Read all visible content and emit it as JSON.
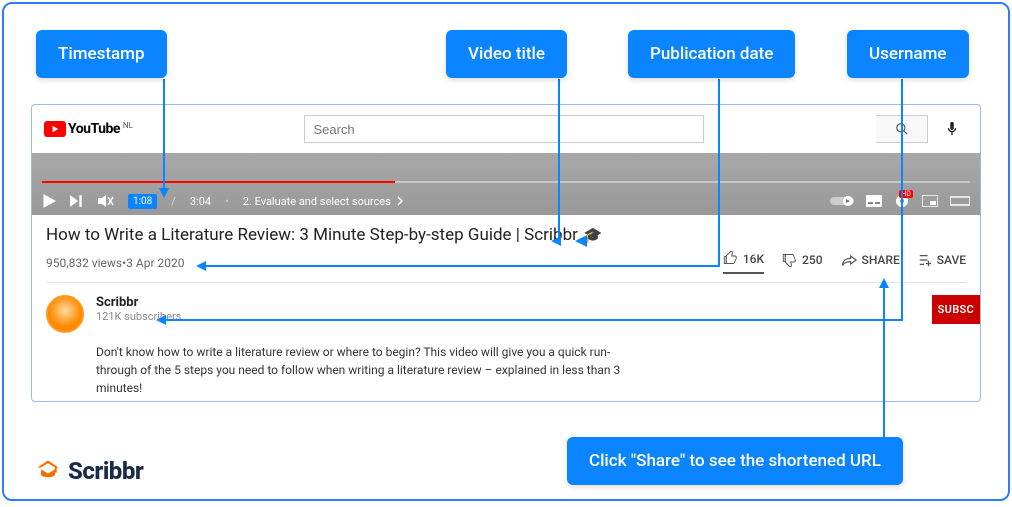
{
  "labels": {
    "timestamp": "Timestamp",
    "video_title": "Video title",
    "publication_date": "Publication date",
    "username": "Username",
    "share_hint": "Click \"Share\" to see the shortened URL"
  },
  "youtube": {
    "logo_text": "YouTube",
    "region": "NL",
    "search_placeholder": "Search"
  },
  "player": {
    "timestamp_badge": "1:08",
    "duration": "3:04",
    "chapter": "2. Evaluate and select sources"
  },
  "video": {
    "title": "How to Write a Literature Review: 3 Minute Step-by-step Guide | Scribbr",
    "views": "950,832 views",
    "date": "3 Apr 2020",
    "separator": " • "
  },
  "actions": {
    "likes": "16K",
    "dislikes": "250",
    "share": "SHARE",
    "save": "SAVE"
  },
  "channel": {
    "name": "Scribbr",
    "subs": "121K subscribers",
    "subscribe": "SUBSC",
    "description": "Don't know how to write a literature review or where to begin? This video will give you a quick run-through of the 5 steps you need to follow when writing a literature review – explained in less than 3 minutes!"
  },
  "brand": {
    "name": "Scribbr"
  }
}
